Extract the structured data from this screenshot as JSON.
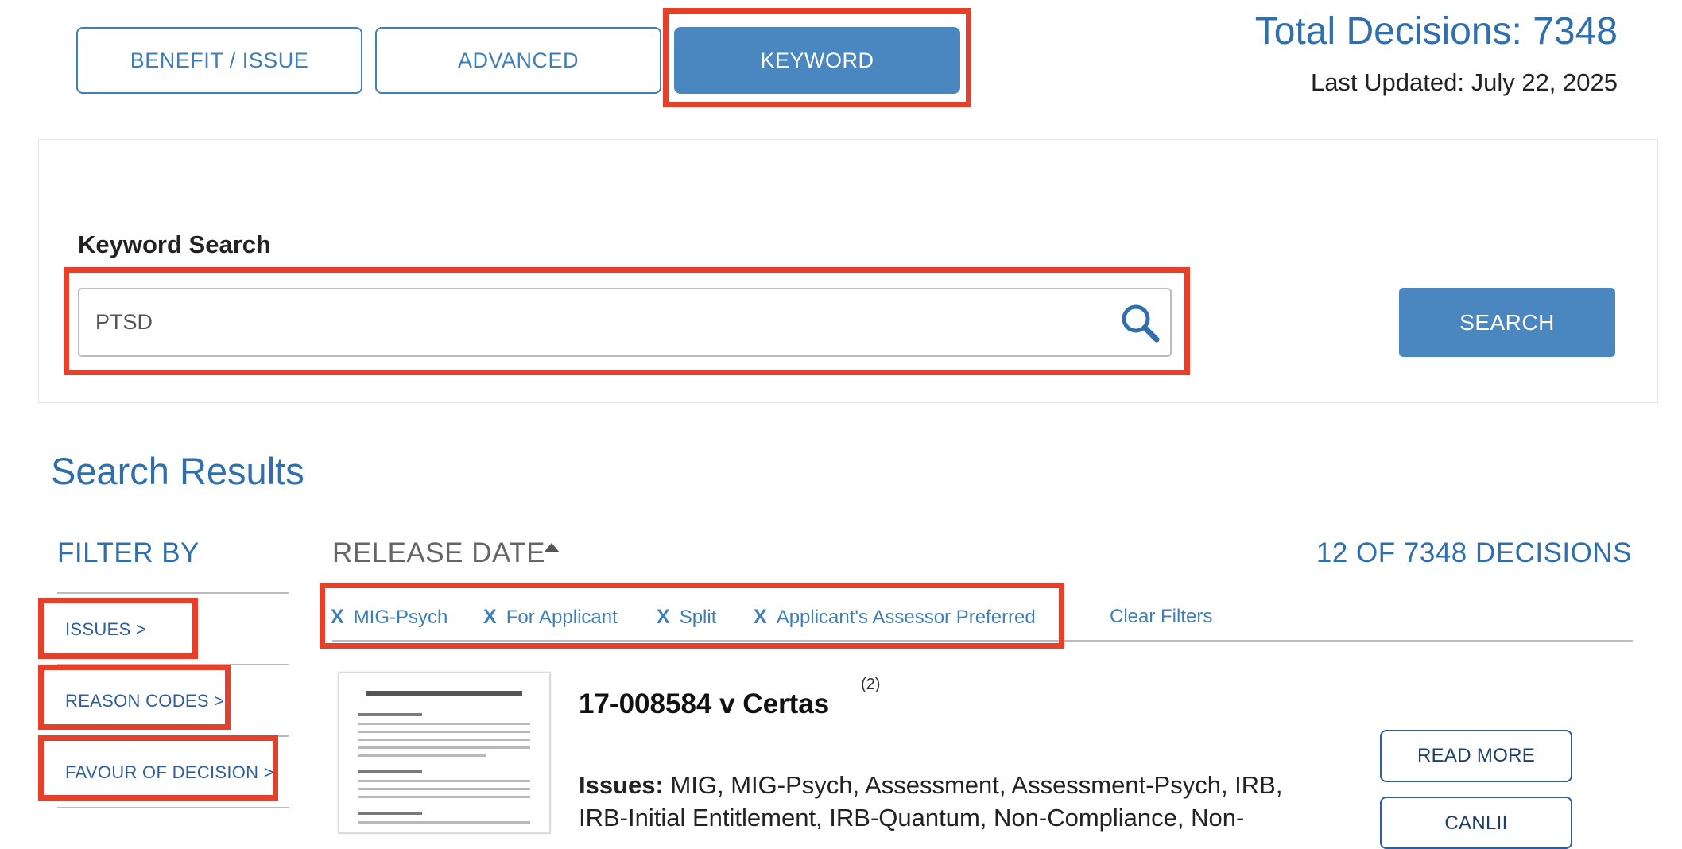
{
  "tabs": {
    "benefit_issue": "BENEFIT / ISSUE",
    "advanced": "ADVANCED",
    "keyword": "KEYWORD",
    "active": "keyword"
  },
  "summary": {
    "total_decisions": "Total Decisions: 7348",
    "last_updated": "Last Updated: July 22, 2025"
  },
  "keyword_search": {
    "label": "Keyword Search",
    "value": "PTSD",
    "button_label": "SEARCH"
  },
  "results": {
    "title": "Search Results",
    "sort_label": "RELEASE DATE",
    "sort_direction": "ascending",
    "count_label": "12 OF 7348 DECISIONS",
    "active_filters": [
      "MIG-Psych",
      "For Applicant",
      "Split",
      "Applicant's Assessor Preferred"
    ],
    "remove_glyph": "X",
    "clear_filters_label": "Clear Filters"
  },
  "sidebar": {
    "title": "FILTER BY",
    "items": [
      "ISSUES >",
      "REASON CODES >",
      "FAVOUR OF DECISION >"
    ]
  },
  "first_result": {
    "title": "17-008584 v Certas",
    "sup": "(2)",
    "issues_label": "Issues:",
    "issues_text": " MIG, MIG-Psych, Assessment, Assessment-Psych, IRB, IRB-Initial Entitlement, IRB-Quantum, Non-Compliance, Non-",
    "read_more_label": "READ MORE",
    "second_button_label": "CANLII"
  },
  "colors": {
    "primary": "#4a87c0",
    "link": "#3f7fb8",
    "heading_blue": "#2f6fae",
    "highlight_red": "#e5402a"
  },
  "icons": {
    "search": "search-icon",
    "sort": "caret-up-icon",
    "remove_filter": "close-icon"
  }
}
